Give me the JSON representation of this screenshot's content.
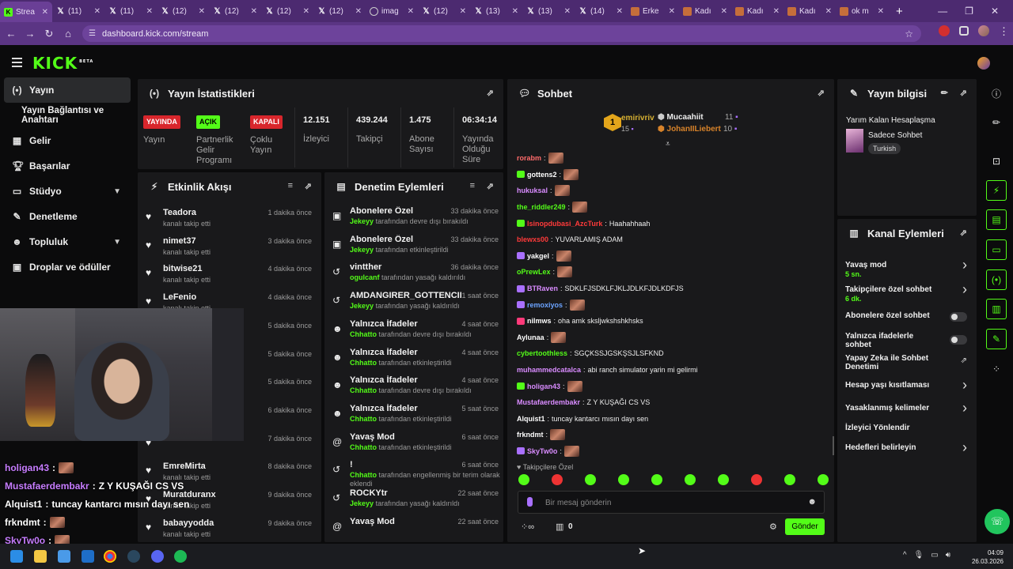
{
  "browser": {
    "tabs": [
      {
        "title": "Strea",
        "icon": "kick-icon"
      },
      {
        "title": "(11)",
        "icon": "x-icon"
      },
      {
        "title": "(11)",
        "icon": "x-icon"
      },
      {
        "title": "(12)",
        "icon": "x-icon"
      },
      {
        "title": "(12)",
        "icon": "x-icon"
      },
      {
        "title": "(12)",
        "icon": "x-icon"
      },
      {
        "title": "(12)",
        "icon": "x-icon"
      },
      {
        "title": "imag",
        "icon": "globe-icon"
      },
      {
        "title": "(12)",
        "icon": "x-icon"
      },
      {
        "title": "(13)",
        "icon": "x-icon"
      },
      {
        "title": "(13)",
        "icon": "x-icon"
      },
      {
        "title": "(14)",
        "icon": "x-icon"
      },
      {
        "title": "Erke",
        "icon": "page-icon"
      },
      {
        "title": "Kadı",
        "icon": "page-icon"
      },
      {
        "title": "Kadı",
        "icon": "page-icon"
      },
      {
        "title": "Kadı",
        "icon": "page-icon"
      },
      {
        "title": "ok m",
        "icon": "page-icon"
      }
    ],
    "url": "dashboard.kick.com/stream"
  },
  "brand": {
    "logo": "KICK",
    "logo_tag": "BETA",
    "accent": "#53fc18"
  },
  "sidebar": {
    "items": [
      {
        "label": "Yayın",
        "icon": "broadcast-icon"
      },
      {
        "label": "Yayın Bağlantısı ve Anahtarı",
        "icon": ""
      },
      {
        "label": "Gelir",
        "icon": "revenue-icon"
      },
      {
        "label": "Başarılar",
        "icon": "trophy-icon"
      },
      {
        "label": "Stüdyo",
        "icon": "studio-icon"
      },
      {
        "label": "Denetleme",
        "icon": "wrench-icon"
      },
      {
        "label": "Topluluk",
        "icon": "community-icon"
      },
      {
        "label": "Droplar ve ödüller",
        "icon": "drops-icon"
      }
    ]
  },
  "stats": {
    "title": "Yayın İstatistikleri",
    "badges": [
      {
        "badge": "YAYINDA",
        "label": "Yayın"
      },
      {
        "badge": "AÇIK",
        "label": "Partnerlik Gelir Programı"
      },
      {
        "badge": "KAPALI",
        "label": "Çoklu Yayın"
      }
    ],
    "values": [
      {
        "value": "12.151",
        "label": "İzleyici"
      },
      {
        "value": "439.244",
        "label": "Takipçi"
      },
      {
        "value": "1.475",
        "label": "Abone Sayısı"
      },
      {
        "value": "06:34:14",
        "label": "Yayında Olduğu Süre"
      }
    ]
  },
  "activity": {
    "title": "Etkinlik Akışı",
    "items": [
      {
        "name": "Teadora",
        "sub": "kanalı takip etti",
        "time": "1 dakika önce"
      },
      {
        "name": "nimet37",
        "sub": "kanalı takip etti",
        "time": "3 dakika önce"
      },
      {
        "name": "bitwise21",
        "sub": "kanalı takip etti",
        "time": "4 dakika önce"
      },
      {
        "name": "LeFenio",
        "sub": "kanalı takip etti",
        "time": "4 dakika önce"
      },
      {
        "name": "",
        "sub": "",
        "time": "5 dakika önce"
      },
      {
        "name": "",
        "sub": "",
        "time": "5 dakika önce"
      },
      {
        "name": "",
        "sub": "",
        "time": "5 dakika önce"
      },
      {
        "name": "",
        "sub": "",
        "time": "6 dakika önce"
      },
      {
        "name": "",
        "sub": "",
        "time": "7 dakika önce"
      },
      {
        "name": "EmreMirta",
        "sub": "kanalı takip etti",
        "time": "8 dakika önce"
      },
      {
        "name": "Muratduranx",
        "sub": "kanalı takip etti",
        "time": "9 dakika önce"
      },
      {
        "name": "babayyodda",
        "sub": "kanalı takip etti",
        "time": "9 dakika önce"
      }
    ]
  },
  "moderation": {
    "title": "Denetim Eylemleri",
    "items": [
      {
        "title": "Abonelere Özel",
        "actor": "Jekeyy",
        "text": "tarafından devre dışı bırakıldı",
        "time": "33 dakika önce",
        "icon": "gift-icon"
      },
      {
        "title": "Abonelere Özel",
        "actor": "Jekeyy",
        "text": "tarafından etkinleştirildi",
        "time": "33 dakika önce",
        "icon": "gift-icon"
      },
      {
        "title": "vintther",
        "actor": "ogulcanf",
        "text": "tarafından yasağı kaldırıldı",
        "time": "36 dakika önce",
        "icon": "undo-icon"
      },
      {
        "title": "AMDANGIRER_GOTTENCIKARIM",
        "actor": "Jekeyy",
        "text": "tarafından yasağı kaldırıldı",
        "time": "1 saat önce",
        "icon": "undo-icon"
      },
      {
        "title": "Yalnızca İfadeler",
        "actor": "Chhatto",
        "text": "tarafından devre dışı bırakıldı",
        "time": "4 saat önce",
        "icon": "smile-icon"
      },
      {
        "title": "Yalnızca İfadeler",
        "actor": "Chhatto",
        "text": "tarafından etkinleştirildi",
        "time": "4 saat önce",
        "icon": "smile-icon"
      },
      {
        "title": "Yalnızca İfadeler",
        "actor": "Chhatto",
        "text": "tarafından devre dışı bırakıldı",
        "time": "4 saat önce",
        "icon": "smile-icon"
      },
      {
        "title": "Yalnızca İfadeler",
        "actor": "Chhatto",
        "text": "tarafından etkinleştirildi",
        "time": "5 saat önce",
        "icon": "smile-icon"
      },
      {
        "title": "Yavaş Mod",
        "actor": "Chhatto",
        "text": "tarafından etkinleştirildi",
        "time": "6 saat önce",
        "icon": "snail-icon"
      },
      {
        "title": "!",
        "actor": "Chhatto",
        "text": "tarafından engellenmiş bir terim olarak eklendi",
        "time": "6 saat önce",
        "icon": "undo-icon"
      },
      {
        "title": "ROCKYtr",
        "actor": "Jekeyy",
        "text": "tarafından yasağı kaldırıldı",
        "time": "22 saat önce",
        "icon": "undo-icon"
      },
      {
        "title": "Yavaş Mod",
        "actor": "",
        "text": "",
        "time": "22 saat önce",
        "icon": "snail-icon"
      }
    ]
  },
  "chat": {
    "title": "Sohbet",
    "leaderboard": [
      {
        "name": "emirivriv",
        "count": "15",
        "rank": "1"
      },
      {
        "name": "Mucaahiit",
        "count": "11"
      },
      {
        "name": "JohanIILiebert",
        "count": "10"
      }
    ],
    "messages": [
      {
        "user": "rorabm",
        "color": "#ff6b6b",
        "text": "",
        "emote": true,
        "badge": ""
      },
      {
        "user": "gottens2",
        "color": "#ffffff",
        "text": "",
        "emote": true,
        "badge": "#53fc18"
      },
      {
        "user": "hukuksal",
        "color": "#d98cff",
        "text": "",
        "emote": true,
        "badge": ""
      },
      {
        "user": "the_riddler249",
        "color": "#53fc18",
        "text": "",
        "emote": true,
        "badge": ""
      },
      {
        "user": "Isinopdubasi_AzcTurk",
        "color": "#ff3a3a",
        "text": "Haahahhaah",
        "emote": false,
        "badge": "#53fc18"
      },
      {
        "user": "blewxs00",
        "color": "#ff3a3a",
        "text": "YUVARLAMIŞ ADAM",
        "emote": false,
        "badge": ""
      },
      {
        "user": "yakgel",
        "color": "#ffffff",
        "text": "",
        "emote": true,
        "badge": "#a970ff"
      },
      {
        "user": "oPrewLex",
        "color": "#53fc18",
        "text": "",
        "emote": true,
        "badge": ""
      },
      {
        "user": "BTRaven",
        "color": "#d98cff",
        "text": "SDKLFJSDKLFJKLJDLKFJDLKDFJS",
        "emote": false,
        "badge": "#a970ff"
      },
      {
        "user": "remoxiyos",
        "color": "#6ba3ff",
        "text": "",
        "emote": true,
        "badge": "#a970ff"
      },
      {
        "user": "nilmws",
        "color": "#ffffff",
        "text": "oha amk sksljwkshshkhsks",
        "emote": false,
        "badge": "#ff3a7a"
      },
      {
        "user": "Aylunaa",
        "color": "#ffffff",
        "text": "",
        "emote": true,
        "badge": ""
      },
      {
        "user": "cybertoothless",
        "color": "#53fc18",
        "text": "SGÇKSSJGSKŞSJLSFKND",
        "emote": false,
        "badge": ""
      },
      {
        "user": "muhammedcatalca",
        "color": "#d98cff",
        "text": "abi ranch simulator yarin mi gelirmi",
        "emote": false,
        "badge": ""
      },
      {
        "user": "holigan43",
        "color": "#d98cff",
        "text": "",
        "emote": true,
        "badge": "#53fc18"
      },
      {
        "user": "Mustafaerdembakr",
        "color": "#d98cff",
        "text": "Z Y KUŞAĞI CS VS",
        "emote": false,
        "badge": ""
      },
      {
        "user": "Alquist1",
        "color": "#ffffff",
        "text": "tuncay kantarcı mısın dayı sen",
        "emote": false,
        "badge": ""
      },
      {
        "user": "frkndmt",
        "color": "#ffffff",
        "text": "",
        "emote": true,
        "badge": ""
      },
      {
        "user": "SkyTw0o",
        "color": "#d98cff",
        "text": "",
        "emote": true,
        "badge": "#a970ff"
      }
    ],
    "followers_only": "Takipçilere Özel",
    "input_placeholder": "Bir mesaj gönderin",
    "send_label": "Gönder",
    "points": "0"
  },
  "stream_info": {
    "title": "Yayın bilgisi",
    "stream_title": "Yarım Kalan Hesaplaşma",
    "category": "Sadece Sohbet",
    "language": "Turkish"
  },
  "channel_actions": {
    "title": "Kanal Eylemleri",
    "items": [
      {
        "label": "Yavaş mod",
        "sub": "5 sn.",
        "control": "chevron"
      },
      {
        "label": "Takipçilere özel sohbet",
        "sub": "6 dk.",
        "control": "chevron"
      },
      {
        "label": "Abonelere özel sohbet",
        "sub": "",
        "control": "toggle"
      },
      {
        "label": "Yalnızca ifadelerle sohbet",
        "sub": "",
        "control": "toggle"
      },
      {
        "label": "Yapay Zeka ile Sohbet Denetimi",
        "sub": "",
        "control": "external"
      },
      {
        "label": "Hesap yaşı kısıtlaması",
        "sub": "",
        "control": "chevron"
      },
      {
        "label": "Yasaklanmış kelimeler",
        "sub": "",
        "control": "chevron"
      },
      {
        "label": "İzleyici Yönlendir",
        "sub": "",
        "control": ""
      },
      {
        "label": "Hedefleri belirleyin",
        "sub": "",
        "control": "chevron"
      }
    ]
  },
  "overlay_chat": [
    {
      "user": "holigan43",
      "text": ""
    },
    {
      "user": "Mustafaerdembakr",
      "text": "Z Y KUŞAĞI CS VS"
    },
    {
      "user": "Alquist1",
      "text": "tuncay kantarcı mısın dayı sen"
    },
    {
      "user": "frkndmt",
      "text": ""
    },
    {
      "user": "SkyTw0o",
      "text": ""
    }
  ],
  "taskbar": {
    "time": "04:09",
    "date": "26.03.2026"
  }
}
